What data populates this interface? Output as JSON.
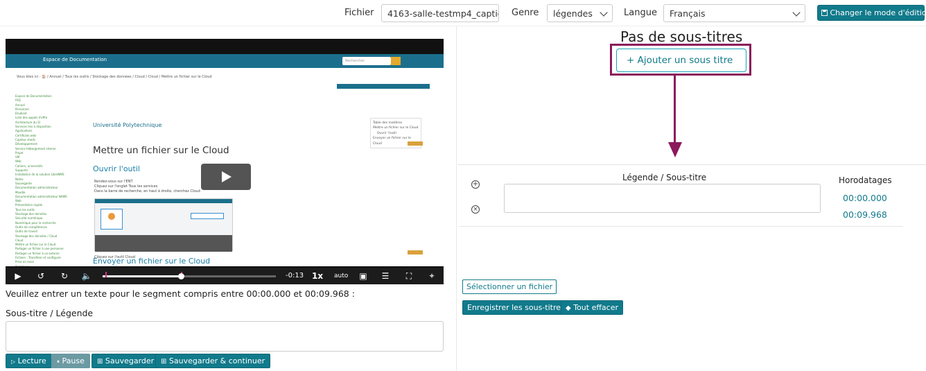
{
  "toolbar": {
    "file_label": "Fichier",
    "file_value": "4163-salle-testmp4_captions",
    "genre_label": "Genre",
    "genre_value": "légendes",
    "language_label": "Langue",
    "language_value": "Français",
    "edit_mode_button": "Changer le mode d'édition"
  },
  "video": {
    "page": {
      "brand": "Espace de Documentation",
      "search_placeholder": "Rechercher",
      "breadcrumb": "Vous êtes ici : 🏠 / Annuel / Tous les outils / Stockage des données / Cloud / Cloud / Mettre un fichier sur le Cloud",
      "logo": "Université Polytechnique",
      "title": "Mettre un fichier sur le Cloud",
      "section1": "Ouvrir l'outil",
      "bullets": [
        "Rendez-vous sur l'ENT",
        "Cliquez sur l'onglet Tous les services",
        "Dans la barre de recherche, en haut à droite, cherchez Cloud"
      ],
      "bullet_after": "Cliquez sur l'outil Cloud",
      "section2": "Envoyer un fichier sur le Cloud",
      "side_menu": [
        "Table des matières",
        "Mettre un fichier sur le Cloud",
        "Ouvrir l'outil",
        "Envoyer un fichier sur le Cloud"
      ],
      "tree": [
        "Espace de Documentation",
        "FAQ",
        "Annuel",
        "Personnel",
        "Etudiant",
        "Liste des appels d'offre",
        "Architecture du SI",
        "Services mis à disposition",
        "Applications",
        "Certificats web",
        "Capteur sheds",
        "Développement",
        "Service hébergement interne",
        "Projet",
        "VM",
        "Web",
        "Cahiers, universités",
        "Supports",
        "Installation de la solution LibreNMS",
        "Notes",
        "Sauvegarde",
        "Documentation administrateur",
        "Moodle",
        "Documentation administrateur NAMS",
        "Web",
        "Présentation rapide",
        "Tous les outils",
        "Stockage des données",
        "Sécurité numérique",
        "Numérique pour la recherche",
        "Outils de compétences",
        "Outils de travail",
        "Stockage des données / Cloud",
        "Cloud",
        "Mettre un fichier sur le Cloud",
        "Partager un fichier à une personne",
        "Partager un fichier à un externe",
        "Fichiers : Transférer et configurer",
        "Prise en main",
        "Plateforme",
        "Informatique",
        "Procédures",
        "Guides"
      ]
    },
    "controls": {
      "time_remaining": "-0:13",
      "speed": "1x",
      "quality": "auto",
      "progress_fraction": 0.45,
      "segment_start_fraction": 0.0,
      "segment_end_fraction": 0.45
    }
  },
  "left": {
    "segment_prompt": "Veuillez entrer un texte pour le segment compris entre 00:00.000 et 00:09.968 :",
    "subtitle_label": "Sous-titre / Légende",
    "buttons": {
      "play": "Lecture",
      "pause": "Pause",
      "save": "Sauvegarder",
      "save_continue": "Sauvegarder & continuer"
    }
  },
  "right": {
    "no_subtitles": "Pas de sous-titres",
    "add_subtitle": "Ajouter un sous titre",
    "caption_header": "Légende / Sous-titre",
    "timestamps_header": "Horodatages",
    "start_time": "00:00.000",
    "end_time": "00:09.968",
    "select_file": "Sélectionner un fichier",
    "save_subtitles": "Enregistrer les sous-titres",
    "clear_all": "Tout effacer"
  },
  "colors": {
    "accent": "#117a8b",
    "highlight": "#8b1a5c"
  }
}
